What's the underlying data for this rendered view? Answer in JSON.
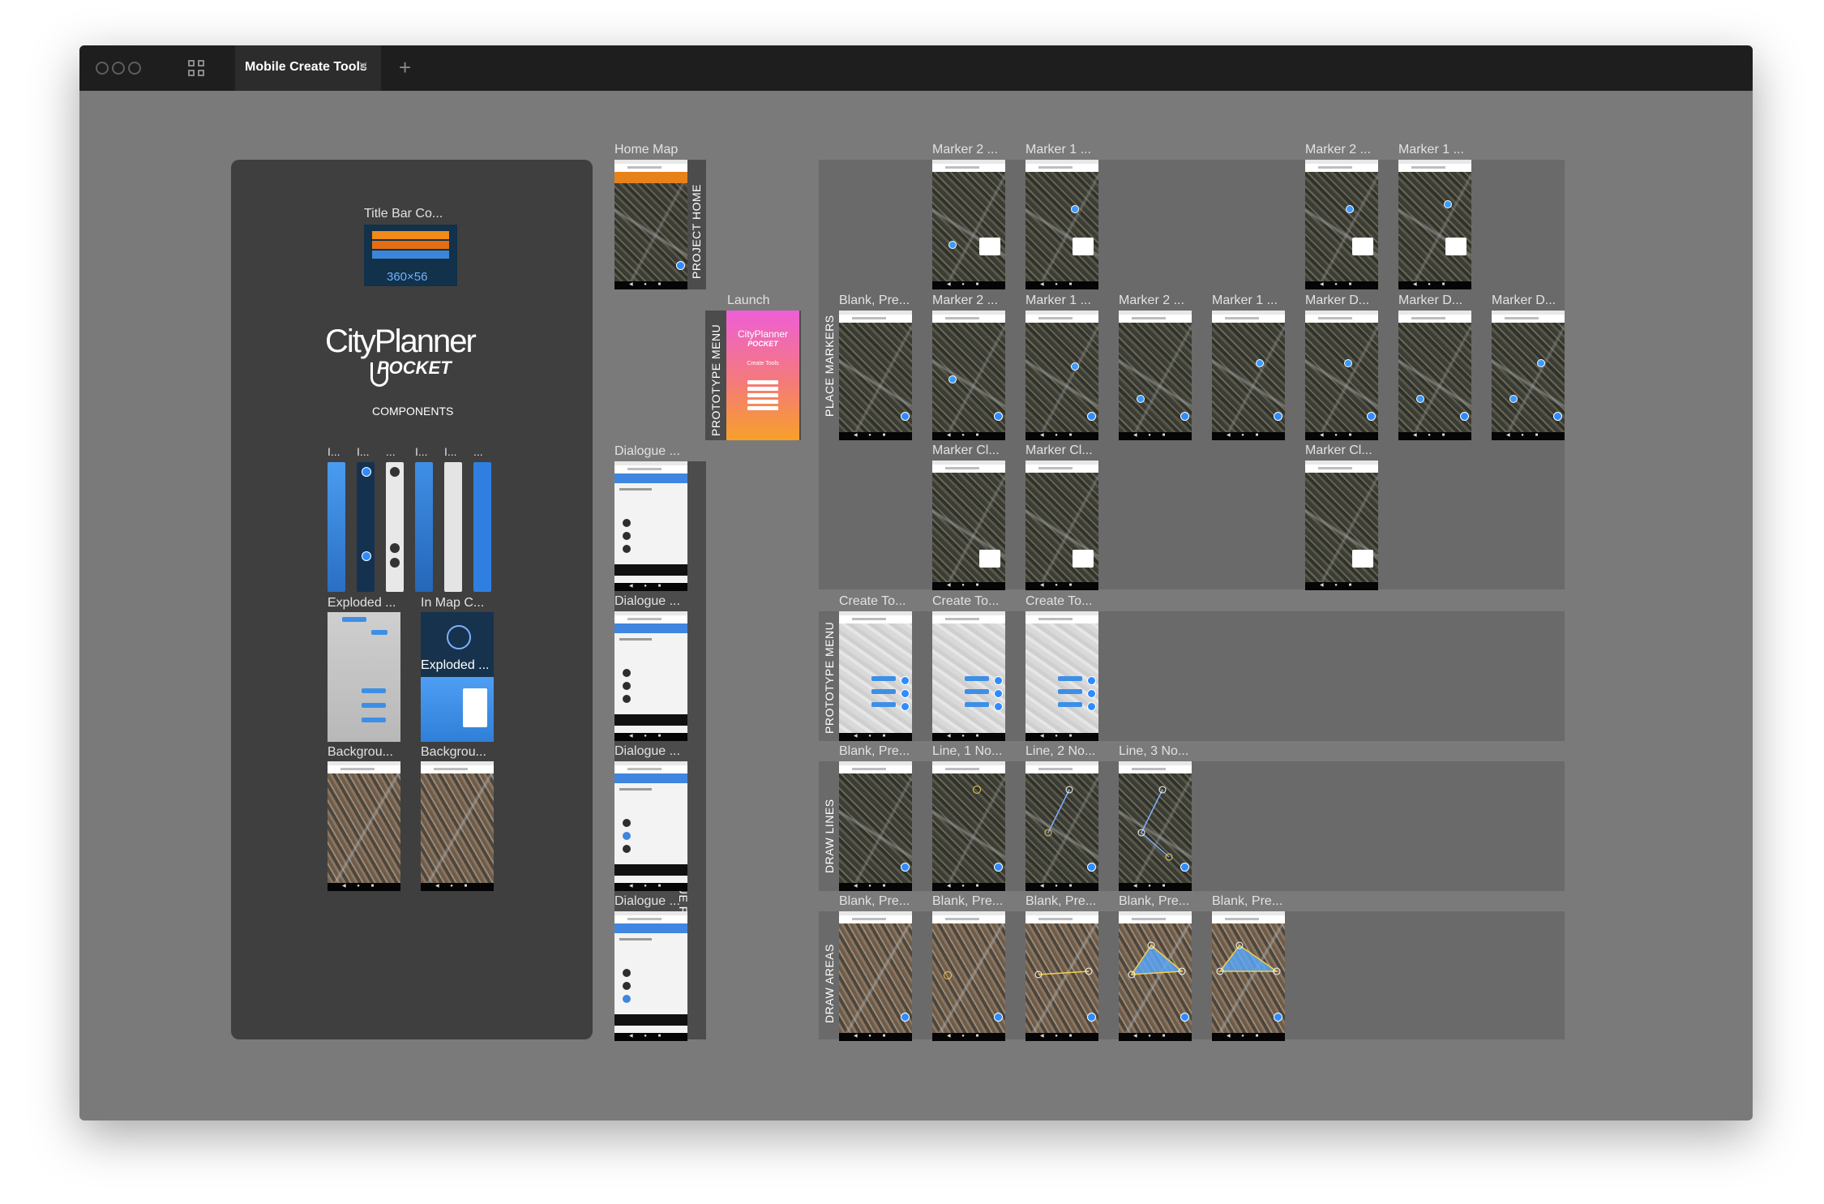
{
  "window": {
    "tab_title": "Mobile Create Tools",
    "tab_close": "×",
    "new_tab": "+"
  },
  "components_panel": {
    "title_bar_label": "Title Bar Co...",
    "title_bar_size": "360×56",
    "logo_city": "CityPlanner",
    "logo_pocket": "POCKET",
    "components_heading": "COMPONENTS",
    "bar_labels": [
      "I...",
      "I...",
      "...",
      "I...",
      "I...",
      "..."
    ],
    "exploded_label_1": "Exploded ...",
    "inmap_label": "In Map C...",
    "exploded_label_2": "Exploded ...",
    "background_label_1": "Backgrou...",
    "background_label_2": "Backgrou..."
  },
  "column_two": {
    "home_map_label": "Home Map",
    "project_home_section": "PROJECT HOME",
    "launch_label": "Launch",
    "prototype_menu_section": "PROTOTYPE MENU",
    "launch_logo": "CityPlanner",
    "launch_pocket": "POCKET",
    "launch_subtitle": "Create Tools",
    "dialogue_form_section": "DIALOGUE FORM",
    "dialogue_labels": [
      "Dialogue ...",
      "Dialogue ...",
      "Dialogue ...",
      "Dialogue ..."
    ]
  },
  "sections": {
    "place_markers": "PLACE MARKERS",
    "prototype_menu": "PROTOTYPE MENU",
    "draw_lines": "DRAW LINES",
    "draw_areas": "DRAW AREAS"
  },
  "place_markers": {
    "row1": [
      "Marker 2 ...",
      "Marker 1 ...",
      "Marker 2 ...",
      "Marker 1 ..."
    ],
    "row2": [
      "Blank, Pre...",
      "Marker 2 ...",
      "Marker 1 ...",
      "Marker 2 ...",
      "Marker 1 ...",
      "Marker D...",
      "Marker D...",
      "Marker D..."
    ],
    "row3": [
      "Marker Cl...",
      "Marker Cl...",
      "Marker Cl..."
    ]
  },
  "prototype_menu_frames": [
    "Create To...",
    "Create To...",
    "Create To..."
  ],
  "draw_lines_frames": [
    "Blank, Pre...",
    "Line, 1 No...",
    "Line, 2 No...",
    "Line, 3 No..."
  ],
  "draw_areas_frames": [
    "Blank, Pre...",
    "Blank, Pre...",
    "Blank, Pre...",
    "Blank, Pre...",
    "Blank, Pre..."
  ],
  "colors": {
    "canvas": "#7a7a7a",
    "titlebar": "#1e1e1e",
    "panel": "#4c4c4c",
    "accent_blue": "#2f8cff",
    "launch_gradient_top": "#ee5fd6",
    "launch_gradient_bottom": "#f7a02a"
  }
}
